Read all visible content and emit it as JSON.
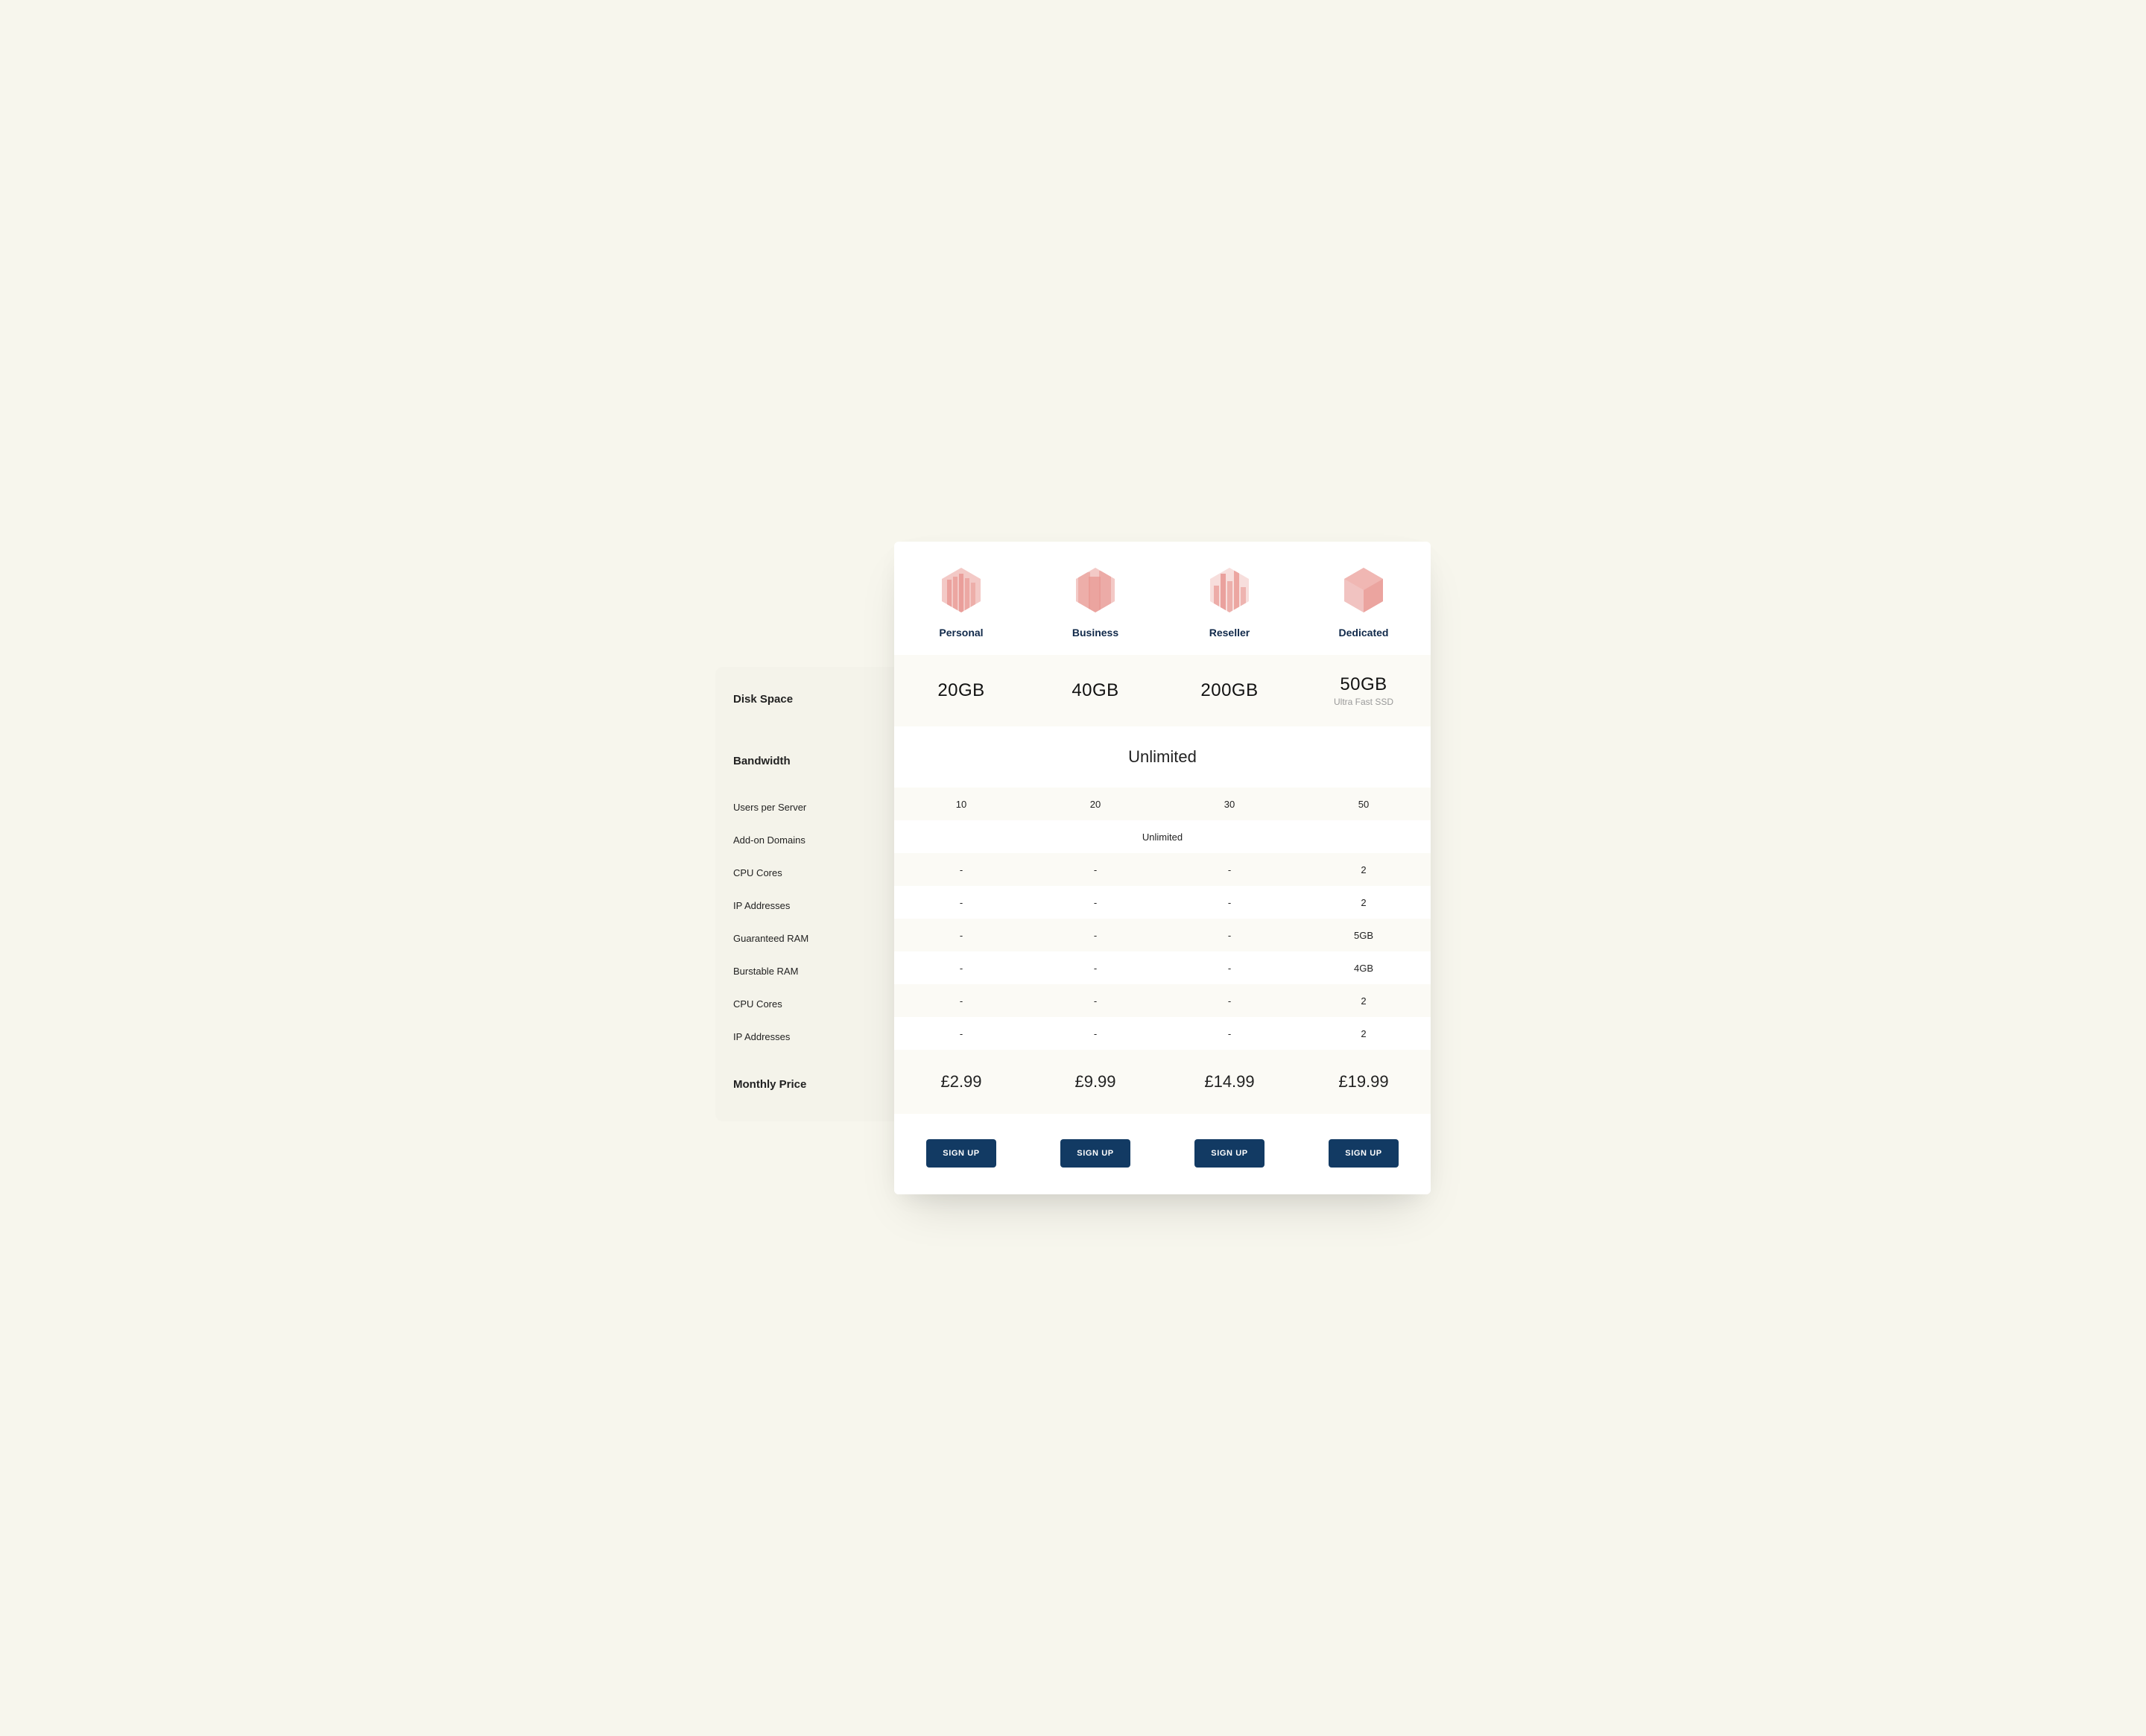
{
  "plans": [
    {
      "name": "Personal",
      "signup": "SIGN UP"
    },
    {
      "name": "Business",
      "signup": "SIGN UP"
    },
    {
      "name": "Reseller",
      "signup": "SIGN UP"
    },
    {
      "name": "Dedicated",
      "signup": "SIGN UP"
    }
  ],
  "rows": {
    "disk_space": {
      "label": "Disk Space",
      "values": [
        "20GB",
        "40GB",
        "200GB",
        "50GB"
      ],
      "sub": [
        "",
        "",
        "",
        "Ultra Fast SSD"
      ]
    },
    "bandwidth": {
      "label": "Bandwidth",
      "span_value": "Unlimited"
    },
    "users_per_server": {
      "label": "Users per Server",
      "values": [
        "10",
        "20",
        "30",
        "50"
      ]
    },
    "addon_domains": {
      "label": "Add-on Domains",
      "span_value": "Unlimited"
    },
    "cpu_cores_1": {
      "label": "CPU Cores",
      "values": [
        "-",
        "-",
        "-",
        "2"
      ]
    },
    "ip_addresses_1": {
      "label": "IP Addresses",
      "values": [
        "-",
        "-",
        "-",
        "2"
      ]
    },
    "guaranteed_ram": {
      "label": "Guaranteed RAM",
      "values": [
        "-",
        "-",
        "-",
        "5GB"
      ]
    },
    "burstable_ram": {
      "label": "Burstable RAM",
      "values": [
        "-",
        "-",
        "-",
        "4GB"
      ]
    },
    "cpu_cores_2": {
      "label": "CPU Cores",
      "values": [
        "-",
        "-",
        "-",
        "2"
      ]
    },
    "ip_addresses_2": {
      "label": "IP Addresses",
      "values": [
        "-",
        "-",
        "-",
        "2"
      ]
    },
    "monthly_price": {
      "label": "Monthly Price",
      "values": [
        "£2.99",
        "£9.99",
        "£14.99",
        "£19.99"
      ]
    }
  },
  "colors": {
    "accent": "#e68a8a",
    "button": "#123a63",
    "brand_text": "#10294a",
    "page_bg": "#f7f6ed"
  }
}
